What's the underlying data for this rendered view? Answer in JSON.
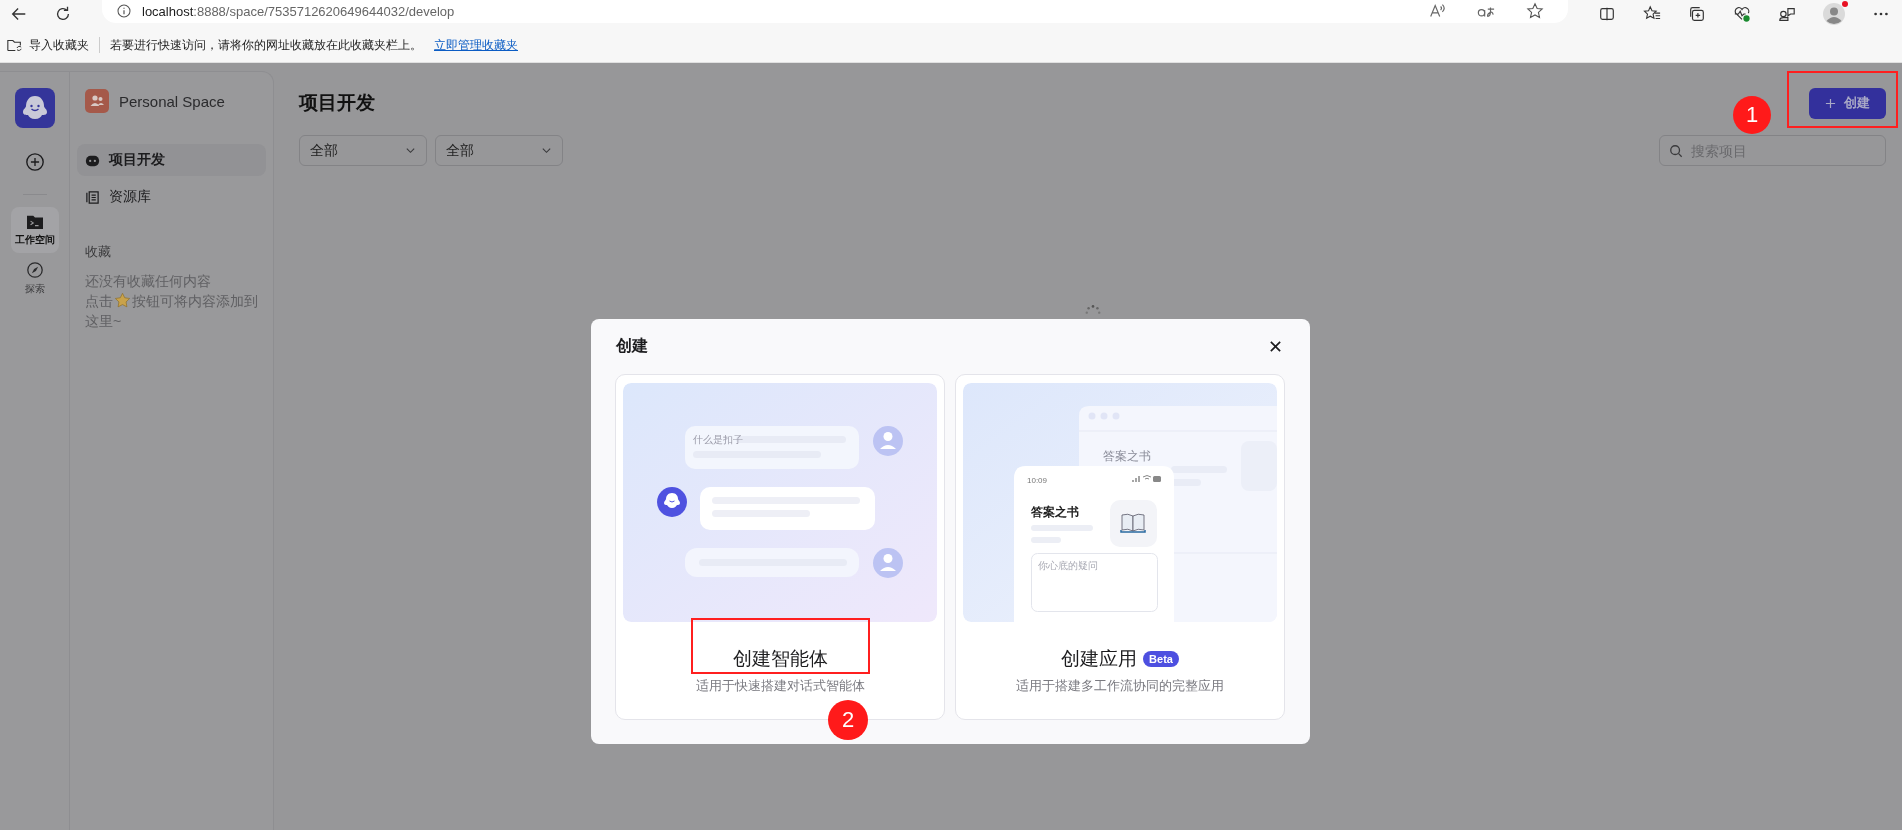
{
  "browser": {
    "url_host": "localhost",
    "url_rest": ":8888/space/7535712620649644032/develop",
    "profile_notification": true
  },
  "bookmarks_bar": {
    "import_label": "导入收藏夹",
    "hint": "若要进行快速访问，请将你的网址收藏放在此收藏夹栏上。",
    "link": "立即管理收藏夹"
  },
  "rail": {
    "items": [
      {
        "kind": "workspace",
        "label": "工作空间",
        "selected": true
      },
      {
        "kind": "explore",
        "label": "探索",
        "selected": false
      }
    ]
  },
  "sidebar": {
    "space_name": "Personal Space",
    "items": [
      {
        "kind": "project",
        "label": "项目开发",
        "selected": true
      },
      {
        "kind": "library",
        "label": "资源库",
        "selected": false
      }
    ],
    "favorites": {
      "title": "收藏",
      "empty_line": "还没有收藏任何内容",
      "hint_before": "点击",
      "hint_after": "按钮可将内容添加到",
      "hint_last": "这里~"
    }
  },
  "main": {
    "title": "项目开发",
    "filters": [
      {
        "value": "全部"
      },
      {
        "value": "全部"
      }
    ],
    "create_button": {
      "label": "创建",
      "annotation": "1"
    },
    "search": {
      "placeholder": "搜索项目"
    },
    "loading": true
  },
  "dialog": {
    "title": "创建",
    "options": [
      {
        "kind": "agent",
        "title": "创建智能体",
        "description": "适用于快速搭建对话式智能体",
        "annotation": "2",
        "illustration": {
          "question": "什么是扣子"
        }
      },
      {
        "kind": "app",
        "title": "创建应用",
        "badge": "Beta",
        "description": "适用于搭建多工作流协同的完整应用",
        "illustration": {
          "time": "10:09",
          "back_title": "答案之书",
          "front_title": "答案之书",
          "input_placeholder": "你心底的疑问"
        }
      }
    ]
  }
}
